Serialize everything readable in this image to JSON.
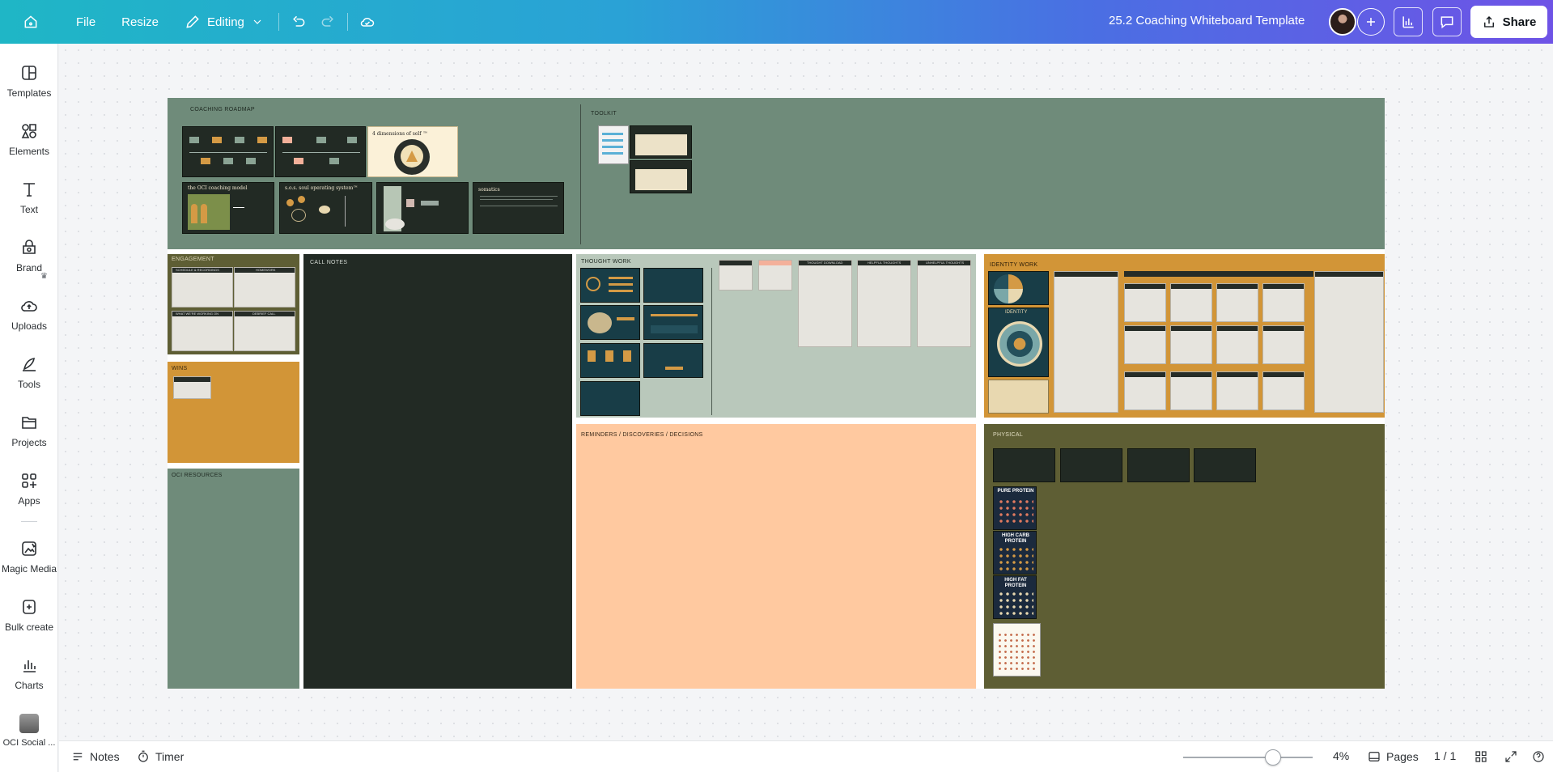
{
  "topbar": {
    "file_label": "File",
    "resize_label": "Resize",
    "editing_label": "Editing",
    "document_title": "25.2 Coaching Whiteboard Template",
    "share_label": "Share"
  },
  "sidebar": {
    "items": [
      {
        "label": "Templates",
        "icon": "templates-icon"
      },
      {
        "label": "Elements",
        "icon": "elements-icon"
      },
      {
        "label": "Text",
        "icon": "text-icon"
      },
      {
        "label": "Brand",
        "icon": "brand-icon"
      },
      {
        "label": "Uploads",
        "icon": "uploads-icon"
      },
      {
        "label": "Tools",
        "icon": "tools-icon"
      },
      {
        "label": "Projects",
        "icon": "projects-icon"
      },
      {
        "label": "Apps",
        "icon": "apps-icon"
      },
      {
        "label": "Magic Media",
        "icon": "magic-media-icon"
      },
      {
        "label": "Bulk create",
        "icon": "bulk-create-icon"
      },
      {
        "label": "Charts",
        "icon": "charts-icon"
      },
      {
        "label": "OCI Social ...",
        "icon": "app-thumbnail"
      }
    ]
  },
  "board": {
    "coaching_roadmap": {
      "label": "COACHING ROADMAP",
      "card_dimensions": "4 dimensions of self ™",
      "card_model": "the OCI coaching model",
      "card_soul": "s.o.s. soul operating system™",
      "card_somatics": "somatics"
    },
    "toolkit": {
      "label": "TOOLKIT"
    },
    "engagement": {
      "label": "ENGAGEMENT",
      "cols": [
        "SCHEDULE & RECORDINGS",
        "HOMEWORK",
        "WHAT WE'RE WORKING ON",
        "DEBRIEF CALL"
      ]
    },
    "call_notes": {
      "label": "CALL NOTES"
    },
    "wins": {
      "label": "WINS"
    },
    "oci_resources": {
      "label": "OCI RESOURCES"
    },
    "thought_work": {
      "label": "THOUGHT WORK",
      "cols": [
        "THOUGHT DOWNLOAD",
        "HELPFUL THOUGHTS",
        "UNHELPFUL THOUGHTS"
      ]
    },
    "identity_work": {
      "label": "IDENTITY WORK",
      "center_label": "IDENTITY"
    },
    "reminders": {
      "label": "REMINDERS / DISCOVERIES / DECISIONS"
    },
    "physical": {
      "label": "PHYSICAL",
      "posters": [
        "PURE PROTEIN",
        "HIGH CARB PROTEIN",
        "HIGH FAT PROTEIN"
      ]
    }
  },
  "bottombar": {
    "notes_label": "Notes",
    "timer_label": "Timer",
    "zoom": "4%",
    "pages_label": "Pages",
    "page_count": "1 / 1"
  },
  "colors": {
    "sage": "#6f8b7a",
    "olive": "#5e5e34",
    "mustard": "#d29537",
    "peach": "#ffc9a0",
    "charcoal": "#222a24",
    "light_sage": "#b9c8bb"
  }
}
